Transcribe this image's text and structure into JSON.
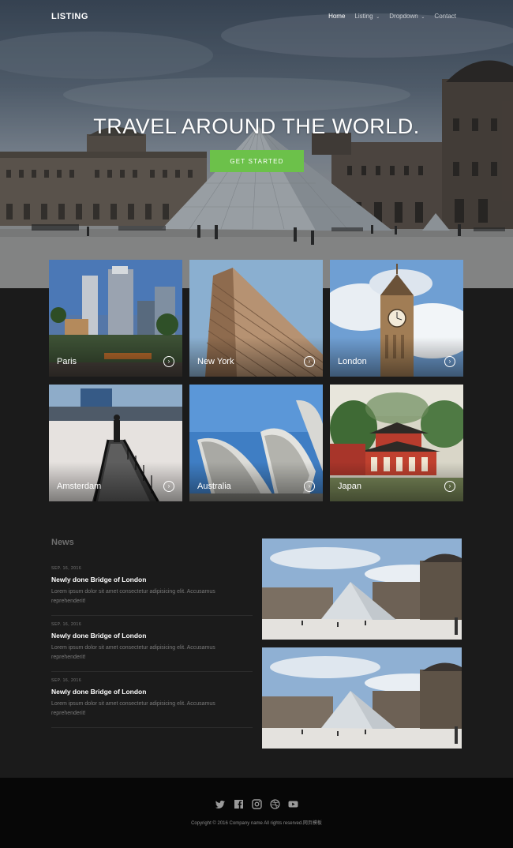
{
  "header": {
    "logo": "LISTING",
    "nav": [
      {
        "label": "Home",
        "active": true,
        "dropdown": false
      },
      {
        "label": "Listing",
        "active": false,
        "dropdown": true
      },
      {
        "label": "Dropdown",
        "active": false,
        "dropdown": true
      },
      {
        "label": "Contact",
        "active": false,
        "dropdown": false
      }
    ]
  },
  "hero": {
    "title": "TRAVEL AROUND THE WORLD.",
    "cta_label": "GET STARTED"
  },
  "destinations": [
    {
      "label": "Paris"
    },
    {
      "label": "New York"
    },
    {
      "label": "London"
    },
    {
      "label": "Amsterdam"
    },
    {
      "label": "Australia"
    },
    {
      "label": "Japan"
    }
  ],
  "news": {
    "heading": "News",
    "items": [
      {
        "date": "SEP. 16, 2016",
        "title": "Newly done Bridge of London",
        "body": "Lorem ipsum dolor sit amet consectetur adipisicing elit. Accusamus reprehenderit!"
      },
      {
        "date": "SEP. 16, 2016",
        "title": "Newly done Bridge of London",
        "body": "Lorem ipsum dolor sit amet consectetur adipisicing elit. Accusamus reprehenderit!"
      },
      {
        "date": "SEP. 16, 2016",
        "title": "Newly done Bridge of London",
        "body": "Lorem ipsum dolor sit amet consectetur adipisicing elit. Accusamus reprehenderit!"
      }
    ]
  },
  "footer": {
    "social_icons": [
      "twitter-icon",
      "facebook-icon",
      "instagram-icon",
      "dribbble-icon",
      "youtube-icon"
    ],
    "copyright": "Copyright © 2016 Company name All rights reserved.网页模板"
  },
  "colors": {
    "accent": "#6cc14a",
    "background": "#1b1b1b",
    "footer": "#070707"
  }
}
